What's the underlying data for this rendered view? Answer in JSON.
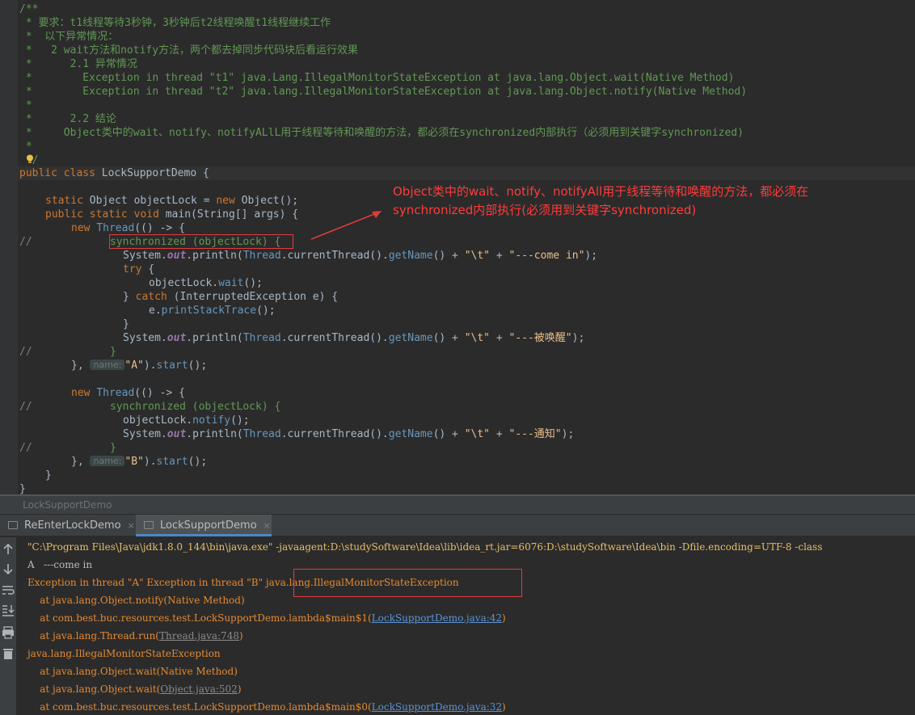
{
  "editor": {
    "doc_comment": [
      "/**",
      " * 要求：t1线程等待3秒钟，3秒钟后t2线程唤醒t1线程继续工作",
      " *  以下异常情况：",
      " *   2 wait方法和notify方法，两个都去掉同步代码块后看运行效果",
      " *      2.1 异常情况",
      " *        Exception in thread \"t1\" java.Lang.IllegalMonitorStateException at java.lang.Object.wait(Native Method)",
      " *        Exception in thread \"t2\" java.lang.IllegalMonitorStateException at java.lang.Object.notify(Native Method)",
      " *",
      " *      2.2 结论",
      " *     Object类中的wait、notify、notifyALlL用于线程等待和唤醒的方法，都必须在synchronized内部执行（必须用到关键字synchronized)",
      " *",
      " */"
    ],
    "class_decl": {
      "kw1": "public",
      "kw2": "class",
      "name": "LockSupportDemo",
      "brace": "{"
    },
    "field": {
      "kw1": "static",
      "type": "Object",
      "name": "objectLock",
      "eq": " = ",
      "kw_new": "new",
      "ctor": "Object",
      "rest": "();"
    },
    "main": {
      "kw1": "public",
      "kw2": "static",
      "kw3": "void",
      "name": "main",
      "rest1": "(",
      "type": "String",
      "rest2": "[] args) {"
    },
    "thread1": {
      "new_kw": "new",
      "thread_cls": "Thread",
      "lambda": "(() -> {",
      "comment_marker": "//",
      "sync": "synchronized (objectLock) {",
      "print1_pre": "System.",
      "out": "out",
      "println": ".println(",
      "thread_cls2": "Thread",
      "current": ".currentThread().",
      "getname": "getName",
      "concat1": "() + ",
      "tab_str": "\"\\t\"",
      "plus": " + ",
      "come_in": "\"---come in\"",
      "end1": ");",
      "try_kw": "try",
      "try_brace": " {",
      "wait_call": "objectLock.",
      "wait_fn": "wait",
      "wait_end": "();",
      "catch_close": "} ",
      "catch_kw": "catch",
      "catch_args": " (InterruptedException e) {",
      "print_stack_pre": "e.",
      "print_stack": "printStackTrace",
      "print_stack_end": "();",
      "close_brace": "}",
      "woken": "\"---被唤醒\"",
      "sync_close": "}",
      "end_prefix": "}, ",
      "hint": "name:",
      "name_val": "\"A\"",
      "start_end": ").",
      "start": "start",
      "start_close": "();"
    },
    "thread2": {
      "sync": "synchronized (objectLock) {",
      "notify_pre": "objectLock.",
      "notify_fn": "notify",
      "notify_end": "();",
      "notified": "\"---通知\"",
      "name_val": "\"B\""
    },
    "closing": [
      "}",
      "}"
    ]
  },
  "annotation": {
    "line1": "Object类中的wait、notify、notifyAll用于线程等待和唤醒的方法，都必须在",
    "line2": "synchronized内部执行(必须用到关键字synchronized)"
  },
  "breadcrumb": "LockSupportDemo",
  "tabs": [
    {
      "label": "ReEnterLockDemo",
      "close": "×",
      "active": false
    },
    {
      "label": "LockSupportDemo",
      "close": "×",
      "active": true
    }
  ],
  "console": {
    "cmd": "\"C:\\Program Files\\Java\\jdk1.8.0_144\\bin\\java.exe\" -javaagent:D:\\studySoftware\\Idea\\lib\\idea_rt.jar=6076:D:\\studySoftware\\Idea\\bin -Dfile.encoding=UTF-8 -class",
    "come_in": "A   ---come in",
    "exc_prefix": "Exception in thread \"A\" Exception in thread \"B\" ",
    "exc_name": "java.lang.IllegalMonitorStateException",
    "at1": "    at java.lang.Object.notify(Native Method)",
    "at2_pre": "    at com.best.buc.resources.test.LockSupportDemo.lambda$main$1(",
    "at2_link": "LockSupportDemo.java:42",
    "at2_post": ")",
    "at3_pre": "    at java.lang.Thread.run(",
    "at3_link": "Thread.java:748",
    "at3_post": ")",
    "exc2": "java.lang.IllegalMonitorStateException",
    "at4": "    at java.lang.Object.wait(Native Method)",
    "at5_pre": "    at java.lang.Object.wait(",
    "at5_link": "Object.java:502",
    "at5_post": ")",
    "at6_pre": "    at com.best.buc.resources.test.LockSupportDemo.lambda$main$0(",
    "at6_link": "LockSupportDemo.java:32",
    "at6_post": ")"
  },
  "side_icons": [
    "up-arrow-icon",
    "down-arrow-icon",
    "soft-wrap-icon",
    "scroll-to-end-icon",
    "print-icon",
    "trash-icon"
  ]
}
